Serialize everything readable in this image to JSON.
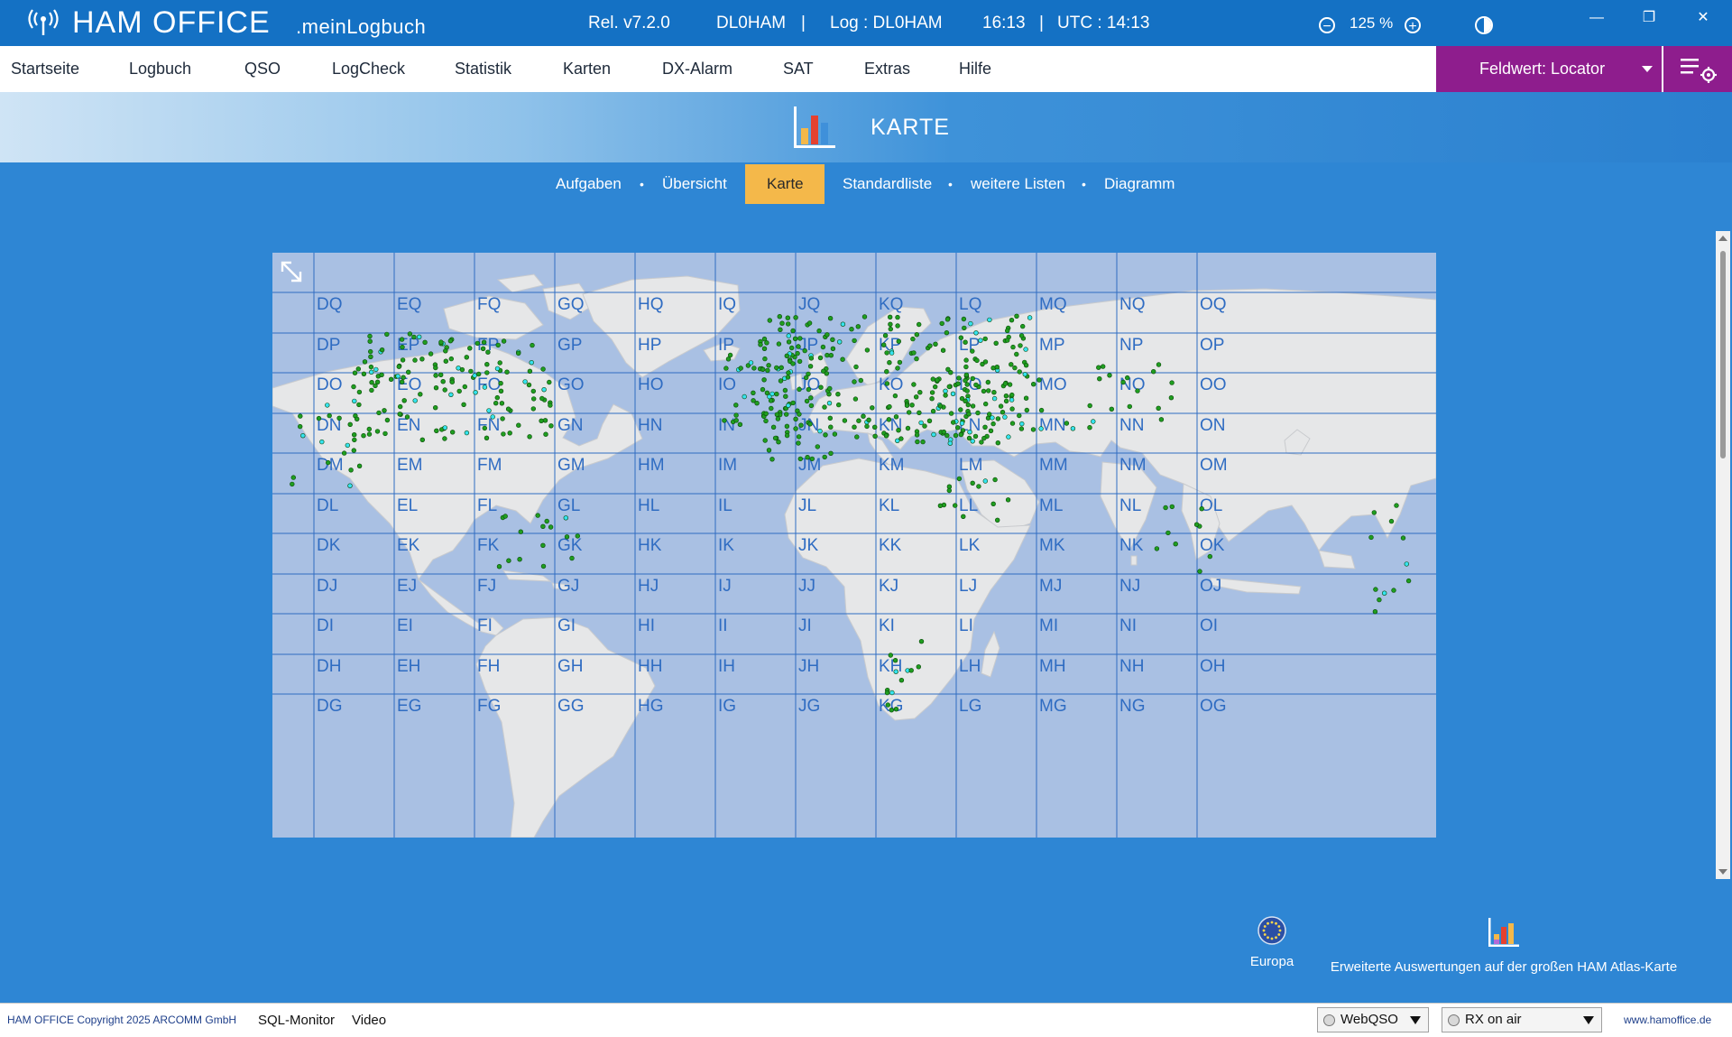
{
  "titlebar": {
    "brand": "HAM OFFICE",
    "brand_sub": ".meinLogbuch",
    "release": "Rel. v7.2.0",
    "callsign": "DL0HAM",
    "sep1": "|",
    "log": "Log : DL0HAM",
    "time_local": "16:13",
    "sep2": "|",
    "time_utc": "UTC : 14:13",
    "zoom": "125 %",
    "zoom_out_glyph": "−",
    "zoom_in_glyph": "+",
    "minimize_glyph": "—",
    "restore_glyph": "❐",
    "close_glyph": "✕"
  },
  "menu": {
    "items": [
      "Startseite",
      "Logbuch",
      "QSO",
      "LogCheck",
      "Statistik",
      "Karten",
      "DX-Alarm",
      "SAT",
      "Extras",
      "Hilfe"
    ],
    "field_value_label": "Feldwert:  Locator"
  },
  "header": {
    "title": "KARTE"
  },
  "subnav": {
    "items": [
      "Aufgaben",
      "Übersicht",
      "Karte",
      "Standardliste",
      "weitere Listen",
      "Diagramm"
    ],
    "active": "Karte",
    "dot": "•"
  },
  "map": {
    "grid_columns": [
      "",
      "D",
      "E",
      "F",
      "G",
      "H",
      "I",
      "J",
      "K",
      "L",
      "M",
      "N",
      "O"
    ],
    "grid_rows": [
      "",
      "Q",
      "P",
      "O",
      "N",
      "M",
      "L",
      "K",
      "J",
      "I",
      "H",
      "G"
    ],
    "colors": {
      "ocean": "#a9c0e3",
      "land": "#e6e7e8",
      "grid": "#2f6cc2",
      "contact_dot": "#1f9e1f",
      "contact_dot_outline": "#0b4a0b",
      "cyan_dot": "#35e3f0"
    }
  },
  "bottom_links": {
    "europa": "Europa",
    "atlas": "Erweiterte Auswertungen auf der großen HAM Atlas-Karte"
  },
  "statusbar": {
    "copyright": "HAM OFFICE Copyright 2025 ARCOMM GmbH",
    "sql_monitor": "SQL-Monitor",
    "video": "Video",
    "webqso": "WebQSO",
    "rx_on_air": "RX on air",
    "website": "www.hamoffice.de"
  }
}
